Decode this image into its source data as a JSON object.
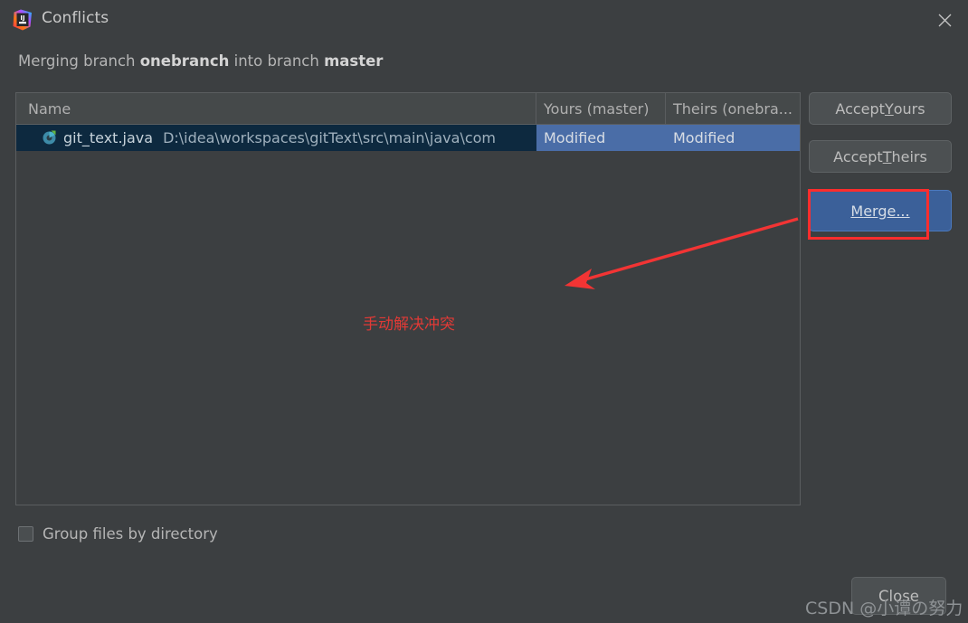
{
  "window": {
    "title": "Conflicts",
    "app_icon": "intellij-idea-icon",
    "close_icon": "close-icon"
  },
  "subtitle": {
    "prefix": "Merging branch ",
    "source_branch": "onebranch",
    "middle": " into branch ",
    "target_branch": "master"
  },
  "table": {
    "columns": [
      {
        "key": "name",
        "label": "Name"
      },
      {
        "key": "yours",
        "label": "Yours (master)"
      },
      {
        "key": "theirs",
        "label": "Theirs (onebra..."
      }
    ],
    "rows": [
      {
        "icon": "git-conflict-icon",
        "file_name": "git_text.java",
        "file_path": "D:\\idea\\workspaces\\gitText\\src\\main\\java\\com",
        "yours": "Modified",
        "theirs": "Modified",
        "selected": true
      }
    ]
  },
  "actions": {
    "accept_yours": {
      "pre": "Accept ",
      "mnemonic": "Y",
      "post": "ours"
    },
    "accept_theirs": {
      "pre": "Accept ",
      "mnemonic": "T",
      "post": "heirs"
    },
    "merge": {
      "pre": "",
      "mnemonic": "M",
      "post": "erge..."
    },
    "close": "Close"
  },
  "options": {
    "group_files_label": "Group files by directory",
    "group_files_checked": false
  },
  "annotations": {
    "note_text": "手动解决冲突",
    "note_color": "#e03a36",
    "highlight_color": "#fd2d2d",
    "arrow_color": "#f23434"
  },
  "watermark": {
    "text": "CSDN @小谭の努力"
  },
  "colors": {
    "window_bg": "#3c3f41",
    "header_bg": "#45494a",
    "row_selected_blue": "#4a6da7",
    "row_name_navy": "#0d293f",
    "default_button_blue": "#3b6099",
    "border": "#5b5e60"
  }
}
